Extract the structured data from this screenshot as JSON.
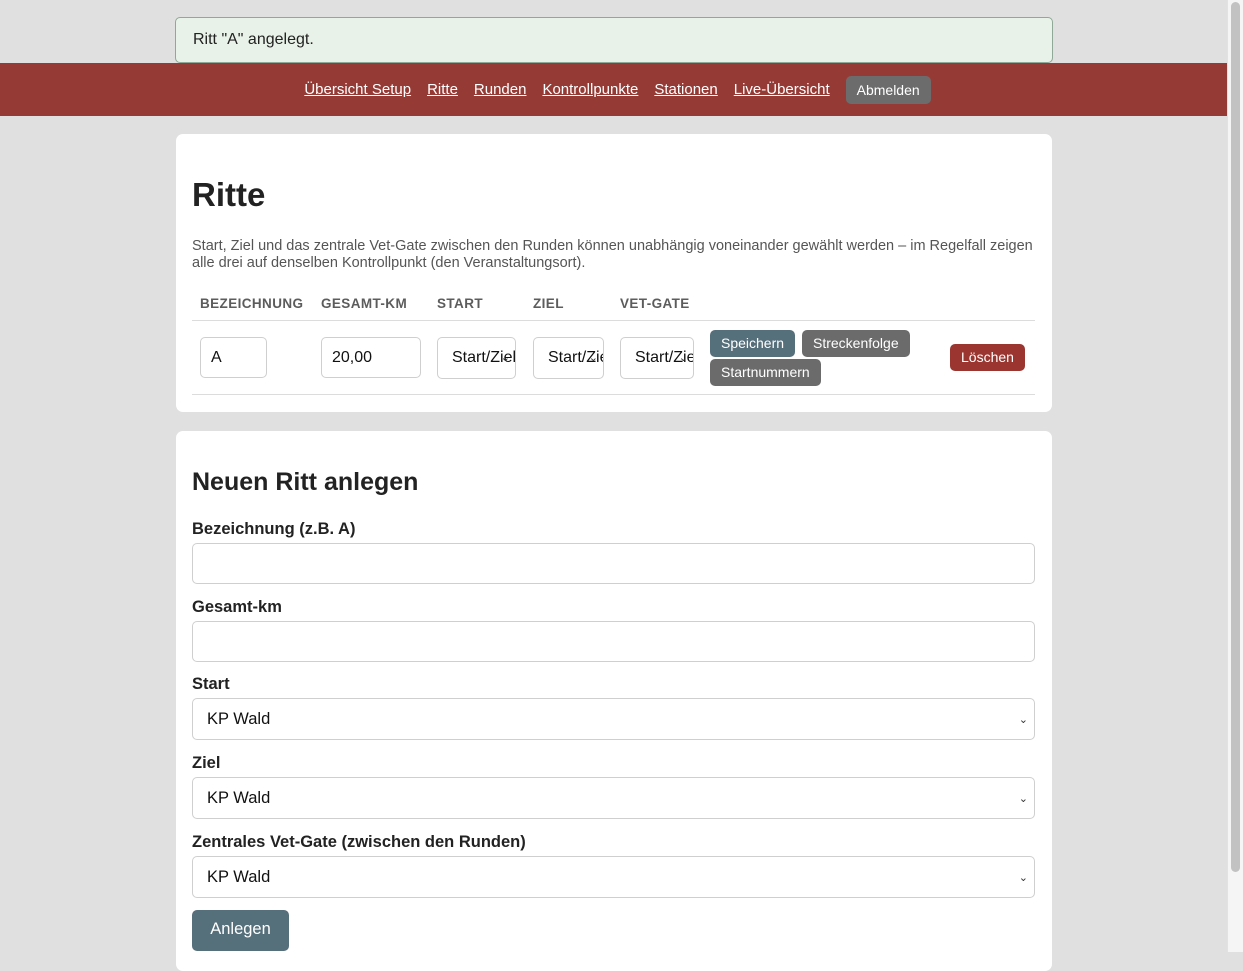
{
  "flash": {
    "message": "Ritt \"A\" angelegt."
  },
  "nav": {
    "items": [
      {
        "label": "Übersicht Setup"
      },
      {
        "label": "Ritte"
      },
      {
        "label": "Runden"
      },
      {
        "label": "Kontrollpunkte"
      },
      {
        "label": "Stationen"
      },
      {
        "label": "Live-Übersicht"
      }
    ],
    "logout_label": "Abmelden"
  },
  "rides": {
    "title": "Ritte",
    "description": "Start, Ziel und das zentrale Vet-Gate zwischen den Runden können unabhängig voneinander gewählt werden – im Regelfall zeigen alle drei auf denselben Kontrollpunkt (den Veranstaltungsort).",
    "columns": [
      "BEZEICHNUNG",
      "GESAMT-KM",
      "START",
      "ZIEL",
      "VET-GATE"
    ],
    "rows": [
      {
        "name": "A",
        "km": "20,00",
        "start": "Start/Ziel",
        "ziel": "Start/Ziel",
        "vet_gate": "Start/Ziel",
        "save_label": "Speichern",
        "route_label": "Streckenfolge",
        "numbers_label": "Startnummern",
        "delete_label": "Löschen"
      }
    ]
  },
  "new_ride": {
    "title": "Neuen Ritt anlegen",
    "name_label": "Bezeichnung (z.B. A)",
    "name_value": "",
    "km_label": "Gesamt-km",
    "km_value": "",
    "start_label": "Start",
    "start_value": "KP Wald",
    "ziel_label": "Ziel",
    "ziel_value": "KP Wald",
    "vet_label": "Zentrales Vet-Gate (zwischen den Runden)",
    "vet_value": "KP Wald",
    "submit_label": "Anlegen"
  }
}
